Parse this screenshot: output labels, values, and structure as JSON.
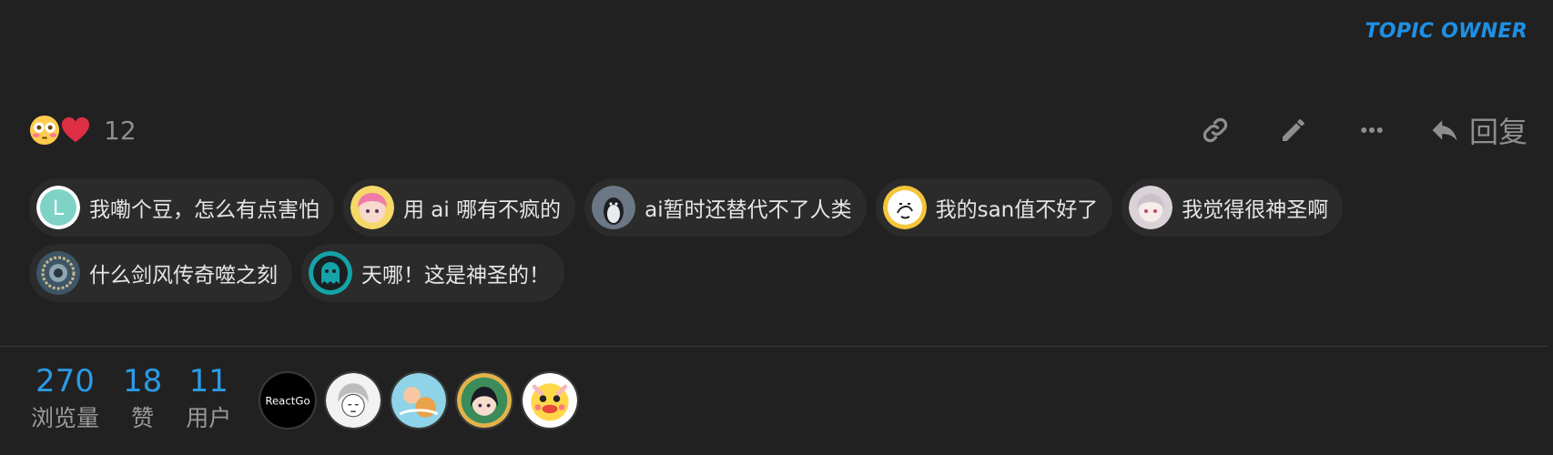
{
  "post": {
    "badge": "TOPIC OWNER",
    "reactions": {
      "emojis": [
        "flushed-face-emoji",
        "red-heart-emoji"
      ],
      "count": "12"
    },
    "actions": {
      "link_icon": "link-icon",
      "edit_icon": "pencil-icon",
      "more_icon": "ellipsis-icon",
      "reply_label": "回复"
    }
  },
  "boosts": [
    {
      "text": "我嘞个豆，怎么有点害怕",
      "avatar": "letter-L-avatar"
    },
    {
      "text": "用 ai 哪有不疯的",
      "avatar": "pink-hair-anime-avatar"
    },
    {
      "text": "ai暂时还替代不了人类",
      "avatar": "penguin-avatar"
    },
    {
      "text": "我的san值不好了",
      "avatar": "doodle-avatar"
    },
    {
      "text": "我觉得很神圣啊",
      "avatar": "anime-girl-avatar"
    },
    {
      "text": "什么剑风传奇噬之刻",
      "avatar": "circular-art-avatar"
    },
    {
      "text": "天哪！这是神圣的！",
      "avatar": "teal-ghost-avatar"
    }
  ],
  "stats": {
    "views": {
      "value": "270",
      "label": "浏览量"
    },
    "likes": {
      "value": "18",
      "label": "赞"
    },
    "users": {
      "value": "11",
      "label": "用户"
    }
  },
  "participants": [
    {
      "name": "ReactGo",
      "avatar": "reactgo-avatar"
    },
    {
      "avatar": "sketch-character-avatar"
    },
    {
      "avatar": "colorful-anime-avatar"
    },
    {
      "avatar": "dark-hair-anime-avatar"
    },
    {
      "avatar": "cartoon-duck-avatar"
    }
  ],
  "colors": {
    "background": "#212121",
    "accent": "#2a9be6",
    "badge": "#1e90e6",
    "chip": "#2b2b2b",
    "muted": "#8e8e8e"
  }
}
